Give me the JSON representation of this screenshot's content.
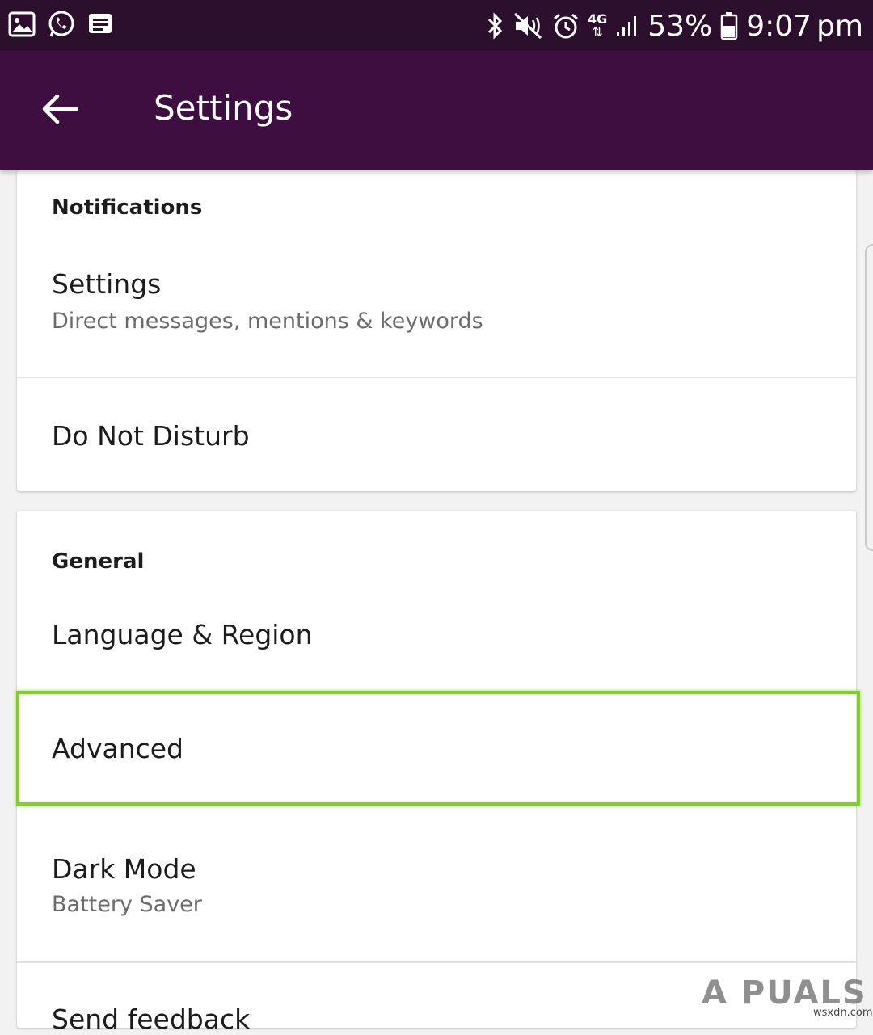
{
  "status_bar": {
    "battery_percent": "53%",
    "time": "9:07",
    "ampm": "pm",
    "network": "4G",
    "left_icons": [
      "gallery-icon",
      "whatsapp-icon",
      "message-icon"
    ],
    "right_icons": [
      "bluetooth-icon",
      "mute-icon",
      "alarm-icon",
      "4g-icon",
      "signal-icon",
      "battery-icon"
    ]
  },
  "app_bar": {
    "title": "Settings",
    "back_icon": "arrow-left-icon"
  },
  "sections": {
    "notifications": {
      "header": "Notifications",
      "settings_title": "Settings",
      "settings_subtitle": "Direct messages, mentions & keywords",
      "dnd_title": "Do Not Disturb"
    },
    "general": {
      "header": "General",
      "language_title": "Language & Region",
      "advanced_title": "Advanced",
      "dark_mode_title": "Dark Mode",
      "dark_mode_subtitle": "Battery Saver",
      "feedback_title": "Send feedback"
    }
  },
  "watermark": {
    "logo_text": "A  PUALS",
    "site": "wsxdn.com"
  },
  "colors": {
    "status_bar_bg": "#2c0f2d",
    "app_bar_bg": "#3f0e40",
    "highlight": "#7ed321"
  }
}
